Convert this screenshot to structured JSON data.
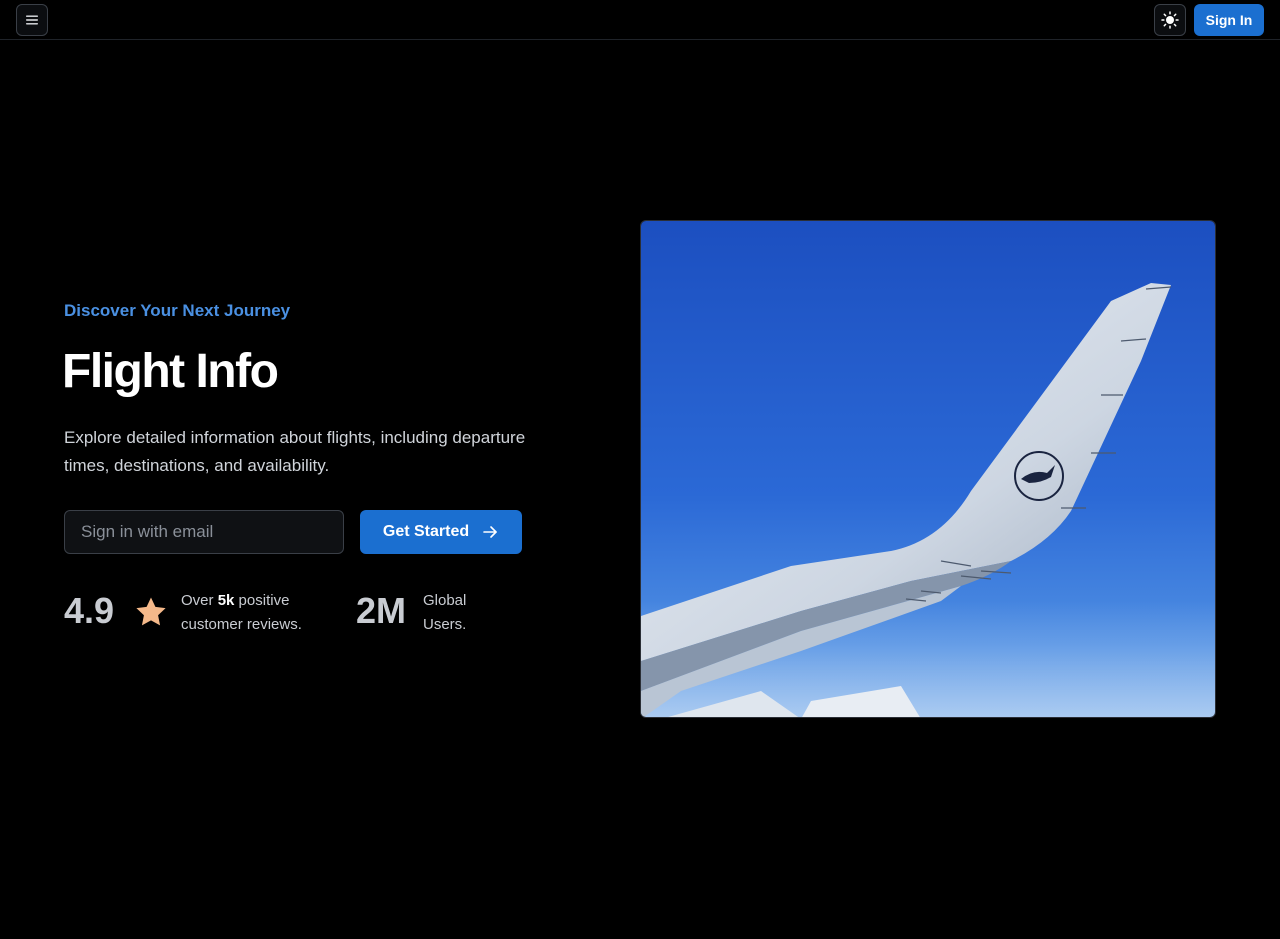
{
  "header": {
    "menu_icon": "hamburger-menu-icon",
    "theme_icon": "sun-icon",
    "signin_label": "Sign In"
  },
  "hero": {
    "eyebrow": "Discover Your Next Journey",
    "title": "Flight Info",
    "description": "Explore detailed information about flights, including departure times, destinations, and availability.",
    "email_placeholder": "Sign in with email",
    "cta_label": "Get Started",
    "cta_icon": "arrow-right-icon"
  },
  "stats": {
    "rating": "4.9",
    "rating_icon": "star-icon",
    "rating_prefix": "Over",
    "rating_count": "5k",
    "rating_suffix": "positive customer reviews.",
    "users": "2M",
    "users_label": "Global Users."
  },
  "colors": {
    "accent": "#1b6fd0",
    "eyebrow": "#4a90e2",
    "star": "#f5b98a",
    "background": "#000000"
  }
}
